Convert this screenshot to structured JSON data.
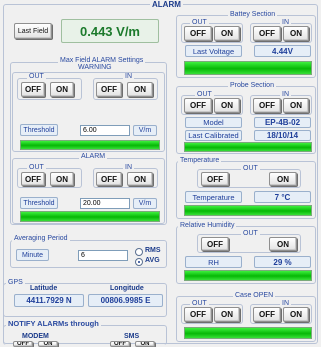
{
  "title": "ALARM",
  "last_field": {
    "button": "Last Field",
    "value": "0.443 V/m"
  },
  "max_field": {
    "title": "Max Field ALARM Settings",
    "warning": {
      "title": "WARNING",
      "out_label": "OUT",
      "in_label": "IN",
      "off": "OFF",
      "on": "ON",
      "threshold_label": "Threshold",
      "threshold_value": "6.00",
      "unit": "V/m"
    },
    "alarm": {
      "title": "ALARM",
      "out_label": "OUT",
      "in_label": "IN",
      "off": "OFF",
      "on": "ON",
      "threshold_label": "Threshold",
      "threshold_value": "20.00",
      "unit": "V/m"
    }
  },
  "averaging": {
    "title": "Averaging Period",
    "unit_label": "Minute",
    "value": "6",
    "rms": "RMS",
    "avg": "AVG",
    "selected": "AVG"
  },
  "gps": {
    "title": "GPS",
    "lat_label": "Latitude",
    "lat_value": "4411.7929 N",
    "lon_label": "Longitude",
    "lon_value": "00806.9985 E"
  },
  "notify": {
    "title": "NOTIFY ALARMs through",
    "modem": {
      "label": "MODEM",
      "off": "OFF",
      "on": "ON"
    },
    "sms": {
      "label": "SMS",
      "off": "OFF",
      "on": "ON"
    }
  },
  "battery": {
    "title": "Battey Section",
    "out_label": "OUT",
    "in_label": "IN",
    "off": "OFF",
    "on": "ON",
    "voltage_label": "Last Voltage",
    "voltage_value": "4.44V"
  },
  "probe": {
    "title": "Probe Section",
    "out_label": "OUT",
    "in_label": "IN",
    "off": "OFF",
    "on": "ON",
    "model_label": "Model",
    "model_value": "EP-4B-02",
    "calibrated_label": "Last Calibrated",
    "calibrated_value": "18/10/14"
  },
  "temperature": {
    "title": "Temperature",
    "out_label": "OUT",
    "off": "OFF",
    "on": "ON",
    "label": "Temperature",
    "value": "7 °C"
  },
  "humidity": {
    "title": "Relative Humidity",
    "out_label": "OUT",
    "off": "OFF",
    "on": "ON",
    "label": "RH",
    "value": "29 %"
  },
  "case_open": {
    "title": "Case OPEN",
    "out_label": "OUT",
    "in_label": "IN",
    "off": "OFF",
    "on": "ON"
  },
  "colors": {
    "indicator": "#06b806",
    "value_text": "#1f3f9a",
    "frame": "#b9c3d6"
  }
}
